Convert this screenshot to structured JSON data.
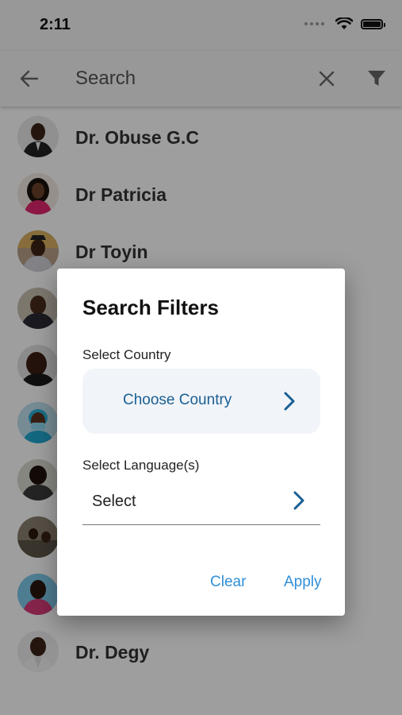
{
  "status_bar": {
    "time": "2:11"
  },
  "app_bar": {
    "search_placeholder": "Search"
  },
  "doctors": [
    {
      "name": "Dr. Obuse G.C"
    },
    {
      "name": "Dr Patricia"
    },
    {
      "name": "Dr Toyin"
    },
    {
      "name": ""
    },
    {
      "name": ""
    },
    {
      "name": ""
    },
    {
      "name": ""
    },
    {
      "name": ""
    },
    {
      "name": ""
    },
    {
      "name": "Dr. Degy"
    }
  ],
  "filter_dialog": {
    "title": "Search Filters",
    "country_label": "Select Country",
    "country_value": "Choose Country",
    "language_label": "Select Language(s)",
    "language_value": "Select",
    "clear_label": "Clear",
    "apply_label": "Apply"
  },
  "colors": {
    "link": "#1a5f94",
    "action": "#2f8fd8",
    "scrim": "#000000"
  }
}
